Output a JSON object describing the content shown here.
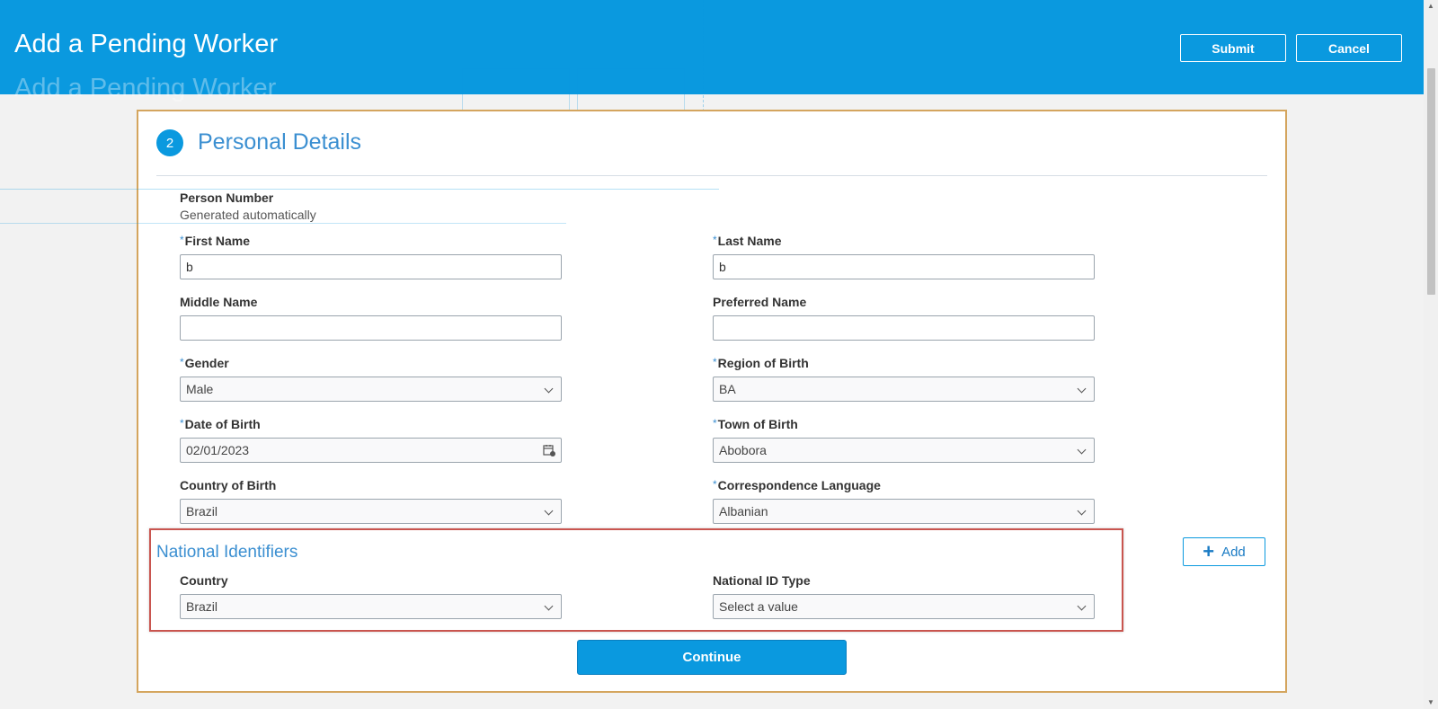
{
  "header": {
    "title": "Add a Pending Worker",
    "submit_label": "Submit",
    "cancel_label": "Cancel"
  },
  "section": {
    "step_number": "2",
    "title": "Personal Details"
  },
  "person_number": {
    "label": "Person Number",
    "value": "Generated automatically"
  },
  "fields": {
    "first_name": {
      "label": "First Name",
      "value": "b",
      "required": true
    },
    "last_name": {
      "label": "Last Name",
      "value": "b",
      "required": true
    },
    "middle_name": {
      "label": "Middle Name",
      "value": ""
    },
    "preferred_name": {
      "label": "Preferred Name",
      "value": ""
    },
    "gender": {
      "label": "Gender",
      "value": "Male",
      "required": true
    },
    "region_of_birth": {
      "label": "Region of Birth",
      "value": "BA",
      "required": true
    },
    "date_of_birth": {
      "label": "Date of Birth",
      "value": "02/01/2023",
      "required": true
    },
    "town_of_birth": {
      "label": "Town of Birth",
      "value": "Abobora",
      "required": true
    },
    "country_of_birth": {
      "label": "Country of Birth",
      "value": "Brazil"
    },
    "correspondence_language": {
      "label": "Correspondence Language",
      "value": "Albanian",
      "required": true
    }
  },
  "national_identifiers": {
    "title": "National Identifiers",
    "add_label": "Add",
    "country": {
      "label": "Country",
      "value": "Brazil"
    },
    "national_id_type": {
      "label": "National ID Type",
      "placeholder": "Select a value"
    }
  },
  "continue_label": "Continue",
  "colors": {
    "header_bg": "#0a99df",
    "accent": "#3b8fd1",
    "highlight_border": "#c9554f",
    "card_border": "#d4a55e"
  },
  "icons": {
    "calendar": "calendar-icon",
    "chevron": "chevron-down-icon",
    "plus": "plus-icon"
  }
}
